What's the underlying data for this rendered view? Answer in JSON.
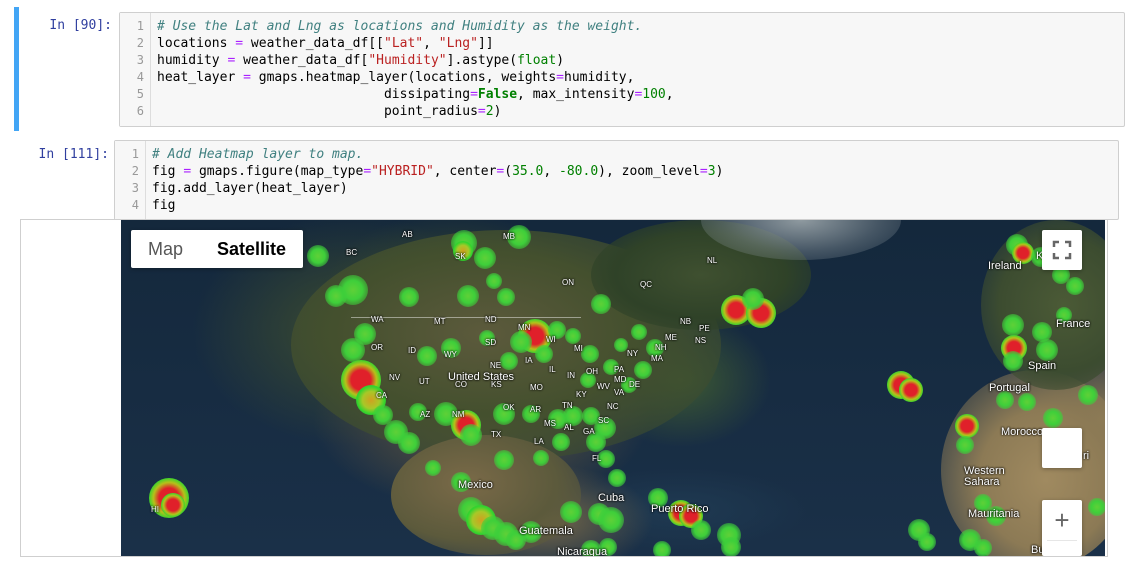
{
  "cells": [
    {
      "prompt": "In [90]:",
      "lines": [
        {
          "n": "1"
        },
        {
          "n": "2"
        },
        {
          "n": "3"
        },
        {
          "n": "4"
        },
        {
          "n": "5"
        },
        {
          "n": "6"
        }
      ]
    },
    {
      "prompt": "In [111]:",
      "lines": [
        {
          "n": "1"
        },
        {
          "n": "2"
        },
        {
          "n": "3"
        },
        {
          "n": "4"
        }
      ]
    }
  ],
  "code": {
    "c1l1": "# Use the Lat and Lng as locations and Humidity as the weight.",
    "c1l2_a": "locations ",
    "c1l2_eq": "=",
    "c1l2_b": " weather_data_df[[",
    "c1l2_s1": "\"Lat\"",
    "c1l2_c": ", ",
    "c1l2_s2": "\"Lng\"",
    "c1l2_d": "]]",
    "c1l3_a": "humidity ",
    "c1l3_eq": "=",
    "c1l3_b": " weather_data_df[",
    "c1l3_s": "\"Humidity\"",
    "c1l3_c": "].astype(",
    "c1l3_f": "float",
    "c1l3_d": ")",
    "c1l4_a": "heat_layer ",
    "c1l4_eq": "=",
    "c1l4_b": " gmaps.heatmap_layer(locations, weights",
    "c1l4_eq2": "=",
    "c1l4_c": "humidity,",
    "c1l5_a": "                             dissipating",
    "c1l5_eq": "=",
    "c1l5_k": "False",
    "c1l5_b": ", max_intensity",
    "c1l5_eq2": "=",
    "c1l5_n": "100",
    "c1l5_c": ",",
    "c1l6_a": "                             point_radius",
    "c1l6_eq": "=",
    "c1l6_n": "2",
    "c1l6_c": ")",
    "c2l1": "# Add Heatmap layer to map.",
    "c2l2_a": "fig ",
    "c2l2_eq": "=",
    "c2l2_b": " gmaps.figure(map_type",
    "c2l2_eq2": "=",
    "c2l2_s": "\"HYBRID\"",
    "c2l2_c": ", center",
    "c2l2_eq3": "=",
    "c2l2_d": "(",
    "c2l2_n1": "35.0",
    "c2l2_e": ", ",
    "c2l2_n2": "-80.0",
    "c2l2_f": "), zoom_level",
    "c2l2_eq4": "=",
    "c2l2_n3": "3",
    "c2l2_g": ")",
    "c2l3": "fig.add_layer(heat_layer)",
    "c2l4": "fig"
  },
  "map": {
    "map_button": "Map",
    "satellite_button": "Satellite",
    "selected_type": "Satellite",
    "zoom_in": "+",
    "labels": {
      "ab": "AB",
      "mb": "MB",
      "bc": "BC",
      "sk": "SK",
      "nl": "NL",
      "on": "ON",
      "qc": "QC",
      "wa": "WA",
      "mt": "MT",
      "nd": "ND",
      "mn": "MN",
      "wi": "WI",
      "mi": "MI",
      "nb": "NB",
      "pe": "PE",
      "me": "ME",
      "ns": "NS",
      "nh": "NH",
      "ny": "NY",
      "ma": "MA",
      "or": "OR",
      "id": "ID",
      "wy": "WY",
      "sd": "SD",
      "ne": "NE",
      "ia": "IA",
      "il": "IL",
      "in": "IN",
      "oh": "OH",
      "pa": "PA",
      "md": "MD",
      "de": "DE",
      "nv": "NV",
      "ut": "UT",
      "co": "CO",
      "ks": "KS",
      "mo": "MO",
      "ky": "KY",
      "wv": "WV",
      "va": "VA",
      "ca": "CA",
      "az": "AZ",
      "nm": "NM",
      "ok": "OK",
      "ar": "AR",
      "tn": "TN",
      "nc": "NC",
      "sc": "SC",
      "ms": "MS",
      "al": "AL",
      "ga": "GA",
      "tx": "TX",
      "la": "LA",
      "fl": "FL",
      "hi": "HI",
      "us": "United States",
      "mexico": "Mexico",
      "cuba": "Cuba",
      "pr": "Puerto Rico",
      "guatemala": "Guatemala",
      "nicaragua": "Nicaragua",
      "ireland": "Ireland",
      "france": "France",
      "spain": "Spain",
      "portugal": "Portugal",
      "morocco": "Morocco",
      "western_sahara": "Western\nSahara",
      "mauritania": "Mauritania",
      "k": "K",
      "bu": "Bu",
      "ri": "ri"
    }
  }
}
